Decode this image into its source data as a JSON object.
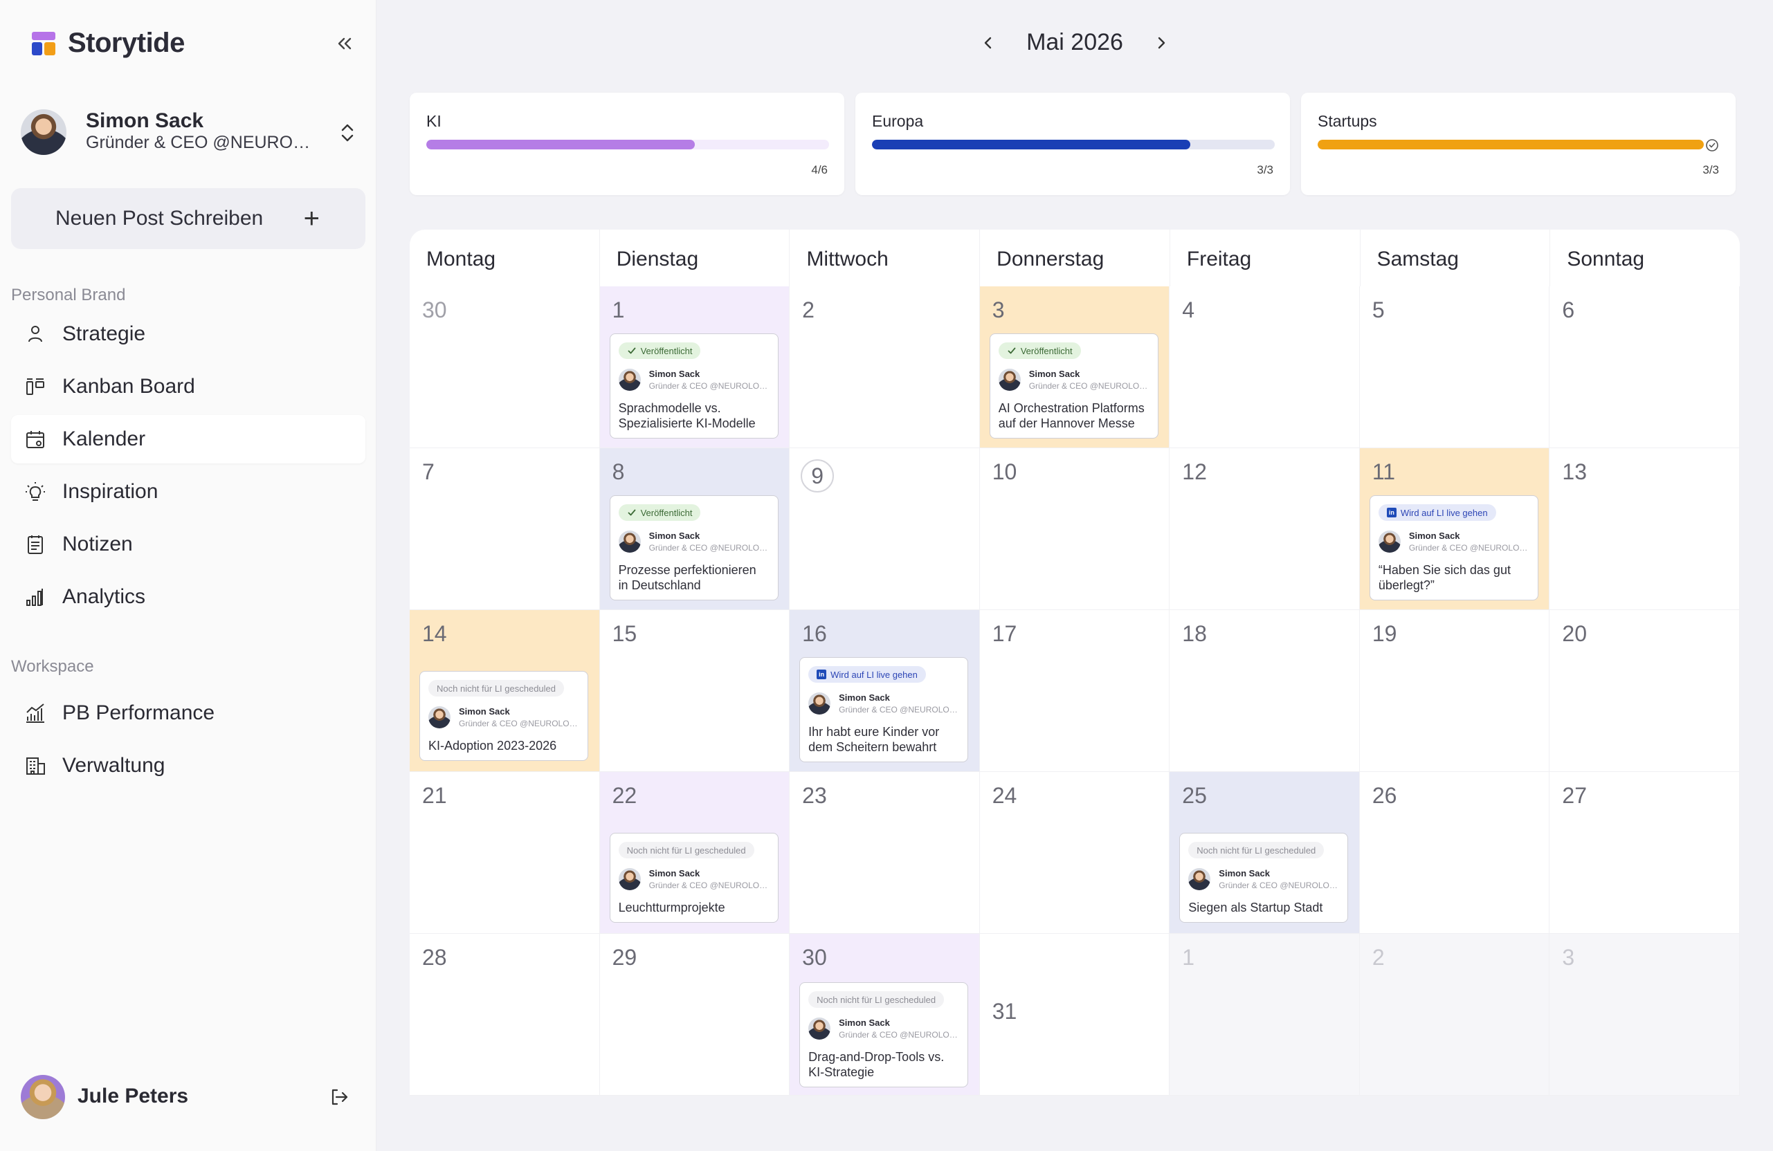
{
  "app": {
    "brand": "Storytide",
    "colors": {
      "ki": "#b57de6",
      "europa": "#1a3fb5",
      "startups": "#f0a112",
      "published": "#3c6a36",
      "live": "#2d46b5"
    }
  },
  "sidebar": {
    "profile": {
      "name": "Simon Sack",
      "subtitle": "Gründer & CEO @NEUROLOGIQ"
    },
    "new_post_label": "Neuen Post Schreiben",
    "section_personal": "Personal Brand",
    "section_workspace": "Workspace",
    "items": [
      {
        "label": "Strategie",
        "icon": "user-icon"
      },
      {
        "label": "Kanban Board",
        "icon": "kanban-icon"
      },
      {
        "label": "Kalender",
        "icon": "calendar-icon",
        "active": true
      },
      {
        "label": "Inspiration",
        "icon": "lightbulb-icon"
      },
      {
        "label": "Notizen",
        "icon": "notes-icon"
      },
      {
        "label": "Analytics",
        "icon": "bar-chart-icon"
      },
      {
        "label": "PB Performance",
        "icon": "trend-chart-icon"
      },
      {
        "label": "Verwaltung",
        "icon": "building-icon"
      }
    ],
    "user": {
      "name": "Jule Peters"
    }
  },
  "calendar": {
    "month_label": "Mai 2026",
    "topics": [
      {
        "name": "KI",
        "progress": 0.667,
        "count": "4/6",
        "color": "#b57de6",
        "track": "#f3ecfc",
        "complete": false
      },
      {
        "name": "Europa",
        "progress": 0.79,
        "count": "3/3",
        "color": "#1a3fb5",
        "track": "#e4e6f2",
        "complete": false
      },
      {
        "name": "Startups",
        "progress": 1.0,
        "count": "3/3",
        "color": "#f0a112",
        "track": "#fdeccb",
        "complete": true
      }
    ],
    "weekdays": [
      "Montag",
      "Dienstag",
      "Mittwoch",
      "Donnerstag",
      "Freitag",
      "Samstag",
      "Sonntag"
    ],
    "author": {
      "name": "Simon Sack",
      "subtitle": "Gründer & CEO @NEUROLOGIQ"
    },
    "status_labels": {
      "published": "Veröffentlicht",
      "live": "Wird auf LI live gehen",
      "pending": "Noch nicht für LI gescheduled"
    },
    "weeks": [
      [
        {
          "day": "30",
          "muted": false,
          "dim": true
        },
        {
          "day": "1",
          "tint": "purple",
          "post": {
            "status": "published",
            "title": "Sprachmodelle vs. Spezialisierte KI-Modelle"
          }
        },
        {
          "day": "2"
        },
        {
          "day": "3",
          "tint": "orange",
          "post": {
            "status": "published",
            "title": "AI Orchestration Platforms auf der Hannover Messe"
          }
        },
        {
          "day": "4"
        },
        {
          "day": "5"
        },
        {
          "day": "6"
        }
      ],
      [
        {
          "day": "7"
        },
        {
          "day": "8",
          "tint": "blue",
          "post": {
            "status": "published",
            "title": "Prozesse perfektionieren in Deutschland"
          }
        },
        {
          "day": "9",
          "today": true
        },
        {
          "day": "10"
        },
        {
          "day": "12"
        },
        {
          "day": "11",
          "tint": "orange",
          "post": {
            "status": "live",
            "title": "“Haben Sie sich das gut überlegt?”"
          }
        },
        {
          "day": "13"
        }
      ],
      [
        {
          "day": "14",
          "tint": "orange",
          "post": {
            "status": "pending",
            "title": "KI-Adoption 2023-2026"
          }
        },
        {
          "day": "15"
        },
        {
          "day": "16",
          "tint": "blue",
          "post": {
            "status": "live",
            "title": "Ihr habt eure Kinder vor dem Scheitern bewahrt"
          }
        },
        {
          "day": "17"
        },
        {
          "day": "18"
        },
        {
          "day": "19"
        },
        {
          "day": "20"
        }
      ],
      [
        {
          "day": "21"
        },
        {
          "day": "22",
          "tint": "purple",
          "post": {
            "status": "pending",
            "title": "Leuchtturmprojekte"
          }
        },
        {
          "day": "23"
        },
        {
          "day": "24"
        },
        {
          "day": "25",
          "tint": "blue",
          "post": {
            "status": "pending",
            "title": "Siegen als Startup Stadt"
          }
        },
        {
          "day": "26"
        },
        {
          "day": "27"
        }
      ],
      [
        {
          "day": "28"
        },
        {
          "day": "29"
        },
        {
          "day": "30",
          "tint": "purple",
          "post": {
            "status": "pending",
            "title": "Drag-and-Drop-Tools vs. KI-Strategie"
          }
        },
        {
          "day": "31",
          "low": true
        },
        {
          "day": "1",
          "muted": true
        },
        {
          "day": "2",
          "muted": true
        },
        {
          "day": "3",
          "muted": true
        }
      ]
    ]
  }
}
